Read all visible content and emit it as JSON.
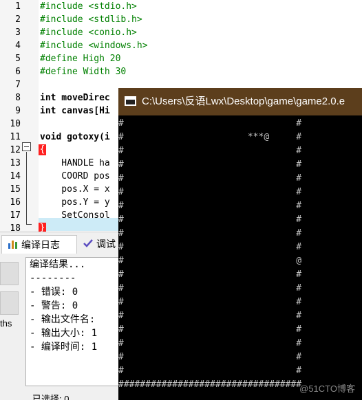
{
  "editor": {
    "lines": [
      {
        "num": "1",
        "text": "#include <stdio.h>"
      },
      {
        "num": "2",
        "text": "#include <stdlib.h>"
      },
      {
        "num": "3",
        "text": "#include <conio.h>"
      },
      {
        "num": "4",
        "text": "#include <windows.h>"
      },
      {
        "num": "5",
        "text": "#define High 20"
      },
      {
        "num": "6",
        "text": "#define Width 30"
      },
      {
        "num": "7",
        "text": ""
      },
      {
        "num": "8",
        "text": "int moveDirec"
      },
      {
        "num": "9",
        "text": "int canvas[Hi"
      },
      {
        "num": "10",
        "text": ""
      },
      {
        "num": "11",
        "text": "void gotoxy(i"
      },
      {
        "num": "12",
        "text": "{"
      },
      {
        "num": "13",
        "text": "    HANDLE ha"
      },
      {
        "num": "14",
        "text": "    COORD pos"
      },
      {
        "num": "15",
        "text": "    pos.X = x"
      },
      {
        "num": "16",
        "text": "    pos.Y = y"
      },
      {
        "num": "17",
        "text": "    SetConsol"
      },
      {
        "num": "18",
        "text": "}"
      }
    ]
  },
  "panel": {
    "tab_compile_log": "编译日志",
    "tab_debug": "调试",
    "side_label": "ths",
    "log_lines": [
      "编译结果...",
      "--------",
      "- 错误: 0",
      "- 警告: 0",
      "- 输出文件名:",
      "- 输出大小: 1",
      "- 编译时间: 1"
    ],
    "status_text": "已选择:  0"
  },
  "console": {
    "title": "C:\\Users\\反语Lwx\\Desktop\\game\\game2.0.e",
    "lines": [
      "#                                #",
      "#                       ***@     #",
      "#                                #",
      "#                                #",
      "#                                #",
      "#                                #",
      "#                                #",
      "#                                #",
      "#                                #",
      "#                                #",
      "#                                @",
      "#                                #",
      "#                                #",
      "#                                #",
      "#                                #",
      "#                                #",
      "#                                #",
      "#                                #",
      "#                                #",
      "##################################"
    ],
    "watermark": "@51CTO博客"
  },
  "colors": {
    "console_title_bg": "#5c3e1c",
    "console_bg": "#000000",
    "console_text": "#c0c0c0",
    "preprocessor": "#008000",
    "current_line": "#cdebf7",
    "brace_highlight": "#ff2020"
  }
}
